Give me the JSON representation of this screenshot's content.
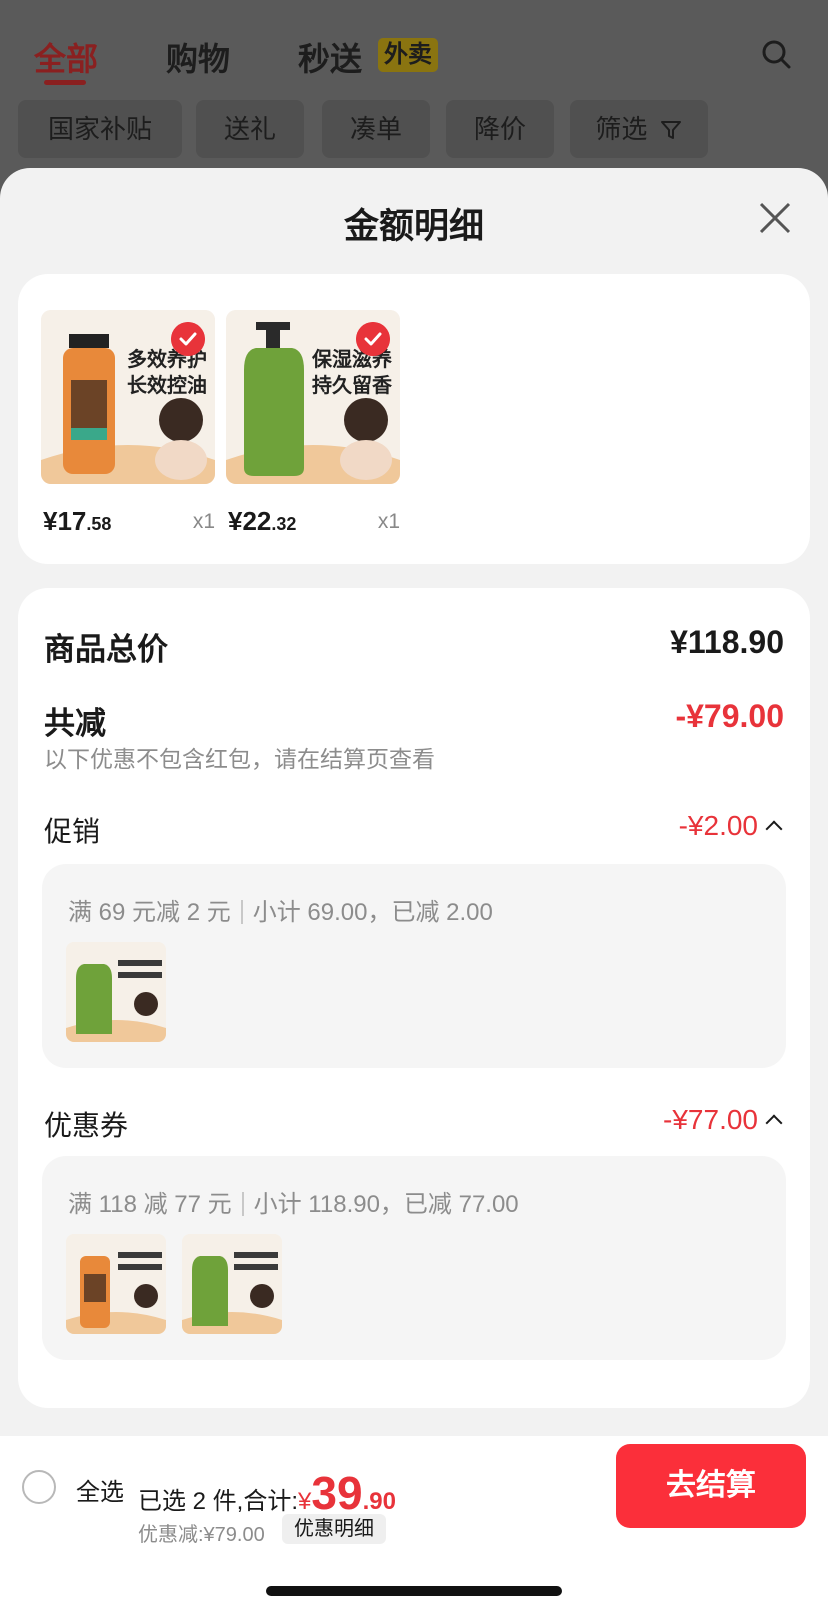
{
  "header": {
    "tabs": [
      "全部",
      "购物",
      "秒送"
    ],
    "badge": "外卖",
    "chips": [
      "国家补贴",
      "送礼",
      "凑单",
      "降价",
      "筛选"
    ]
  },
  "sheet": {
    "title": "金额明细",
    "products": [
      {
        "price_int": "¥17",
        "price_dec": ".58",
        "qty": "x1",
        "thumb_text": "多效养护 长效控油",
        "color": "#e8893a"
      },
      {
        "price_int": "¥22",
        "price_dec": ".32",
        "qty": "x1",
        "thumb_text": "保湿滋养 持久留香",
        "color": "#6fa23a"
      }
    ],
    "total_label": "商品总价",
    "total_value": "¥118.90",
    "reduce_label": "共减",
    "reduce_value": "-¥79.00",
    "note": "以下优惠不包含红包，请在结算页查看",
    "promo": {
      "label": "促销",
      "value": "-¥2.00",
      "rule": "满 69 元减 2 元",
      "subtotal": "小计 69.00，已减 2.00"
    },
    "coupon": {
      "label": "优惠券",
      "value": "-¥77.00",
      "rule": "满 118 减 77 元",
      "subtotal": "小计 118.90，已减 77.00"
    }
  },
  "bottom": {
    "select_all": "全选",
    "summary_prefix": "已选 2 件,合计:",
    "total_currency": "¥",
    "total_int": "39",
    "total_dec": ".90",
    "discount": "优惠减:¥79.00",
    "detail_link": "优惠明细",
    "checkout": "去结算"
  },
  "colors": {
    "accent_red": "#e8333a",
    "checkout_bg": "#fb2f3a"
  }
}
